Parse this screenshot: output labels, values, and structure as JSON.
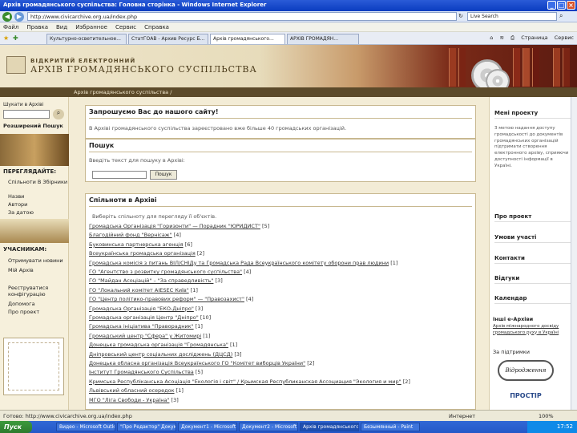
{
  "window": {
    "title": "Архів громадянського суспільства: Головна сторінка - Windows Internet Explorer",
    "address": "http://www.civicarchive.org.ua/index.php",
    "search_placeholder": "Live Search"
  },
  "menu": [
    "Файл",
    "Правка",
    "Вид",
    "Избранное",
    "Сервис",
    "Справка"
  ],
  "tabs": [
    "Культурно-осветительное...",
    "СтатГОАВ - Архив Ресурс Б...",
    "Архів громадянського...",
    "АРХІВ ГРОМАДЯН..."
  ],
  "commands": [
    "Страница",
    "Сервис"
  ],
  "banner": {
    "top_line": "ВІДКРИТИЙ ЕЛЕКТРОННИЙ",
    "title": "АРХІВ ГРОМАДЯНСЬКОГО СУСПІЛЬСТВА"
  },
  "breadcrumb": "Архів громадянського суспільства /",
  "left": {
    "search_label": "Шукати в Архіві",
    "advanced_search": "Розширений Пошук",
    "browse_title": "ПЕРЕГЛЯДАЙТЕ:",
    "browse_items": [
      "Спільноти В Збірники",
      "Назви",
      "Автори",
      "За датою"
    ],
    "participants_title": "УЧАСНИКАМ:",
    "participant_items": [
      "Отримувати новини",
      "Мій Архів",
      "Реєструватися конфігурацію",
      "Допомога",
      "Про проект"
    ]
  },
  "main": {
    "welcome_title": "Запрошуємо Вас до нашого сайту!",
    "welcome_text": "В Архіві громадянського суспільства зареєстровано вже більше 40 громадських організацій.",
    "search_title": "Пошук",
    "search_hint": "Введіть текст для пошуку в Архіві:",
    "search_button": "Пошук",
    "communities_title": "Спільноти в Архіві",
    "communities_hint": "Виберіть спільноту для перегляду її об'єктів.",
    "communities": [
      {
        "name": "Громадська Організація \"Горизонти\" — Порадник \"ЮРИДИСТ\"",
        "count": "[5]"
      },
      {
        "name": "Благодійний фонд \"Вернісаж\"",
        "count": "[4]"
      },
      {
        "name": "Буковинська партнерська агенція",
        "count": "[6]"
      },
      {
        "name": "Всеукраїнська громадська організація",
        "count": "[2]"
      },
      {
        "name": "Громадська комісія з питань ВІЛ/СНІДу та Громадська Рада Всеукраїнського комітету оборони прав людини",
        "count": "[1]"
      },
      {
        "name": "ГО \"Агентство з розвитку громадянського суспільства\"",
        "count": "[4]"
      },
      {
        "name": "ГО \"Майдан Асоціацій\" – \"За справедливість\"",
        "count": "[3]"
      },
      {
        "name": "ГО \"Локальний комітет AIESEC Київ\"",
        "count": "[1]"
      },
      {
        "name": "ГО \"Центр політико-правових реформ\" — \"Правозахист\"",
        "count": "[4]"
      },
      {
        "name": "Громадська Організація \"ЕКО-Дніпро\"",
        "count": "[3]"
      },
      {
        "name": "Громадська організація Центр \"Дніпро\"",
        "count": "[10]"
      },
      {
        "name": "Громадська ініціатива \"Праворадник\"",
        "count": "[1]"
      },
      {
        "name": "Громадський центр \"Сфера\" у Житомирі",
        "count": "[1]"
      },
      {
        "name": "Донецька громадська організація \"Громадянська\"",
        "count": "[1]"
      },
      {
        "name": "Дніпровський центр соціальних досліджень (ДЦСД)",
        "count": "[3]"
      },
      {
        "name": "Донецька обласна організація Всеукраїнського ГО \"Комітет виборців України\"",
        "count": "[2]"
      },
      {
        "name": "Інститут Громадянського Суспільства",
        "count": "[5]"
      },
      {
        "name": "Кримська Республіканська Асоціація \"Екологія і світ\" / Крымская Республиканская Ассоциация \"Экология и мир\"",
        "count": "[2]"
      },
      {
        "name": "Львівський обласний осередок",
        "count": "[1]"
      },
      {
        "name": "МГО \"Ліга Свободи - Україна\"",
        "count": "[3]"
      }
    ]
  },
  "right": {
    "project_news_title": "Мені проекту",
    "project_news_text": "З метою надання доступу громадськості до документів громадянських організацій підтримати створення електронного архіву, сприяючи доступності інформації в Україні.",
    "items": [
      "Про проект",
      "Умови участі",
      "Контакти",
      "Відгуки",
      "Календар"
    ],
    "other_archives_title": "Інші e-Архіви",
    "other_archives_text": "Архів міжнародного досвіду громадського руху в Україні",
    "supported_title": "За підтримки",
    "sponsor1": "Відродження",
    "sponsor2": "ПРОСТІР"
  },
  "status": {
    "text": "Готово: http://www.civicarchive.org.ua/index.php",
    "zone": "Интернет",
    "zoom": "100%"
  },
  "taskbar": {
    "start": "Пуск",
    "items": [
      "Видео - Microsoft Outlook",
      "\"Про Редактор\" Документ...",
      "Документ1 - Microsoft...",
      "Документ2 - Microsoft...",
      "Архів громадянського...",
      "Безымянный - Paint"
    ],
    "clock": "17:52"
  }
}
